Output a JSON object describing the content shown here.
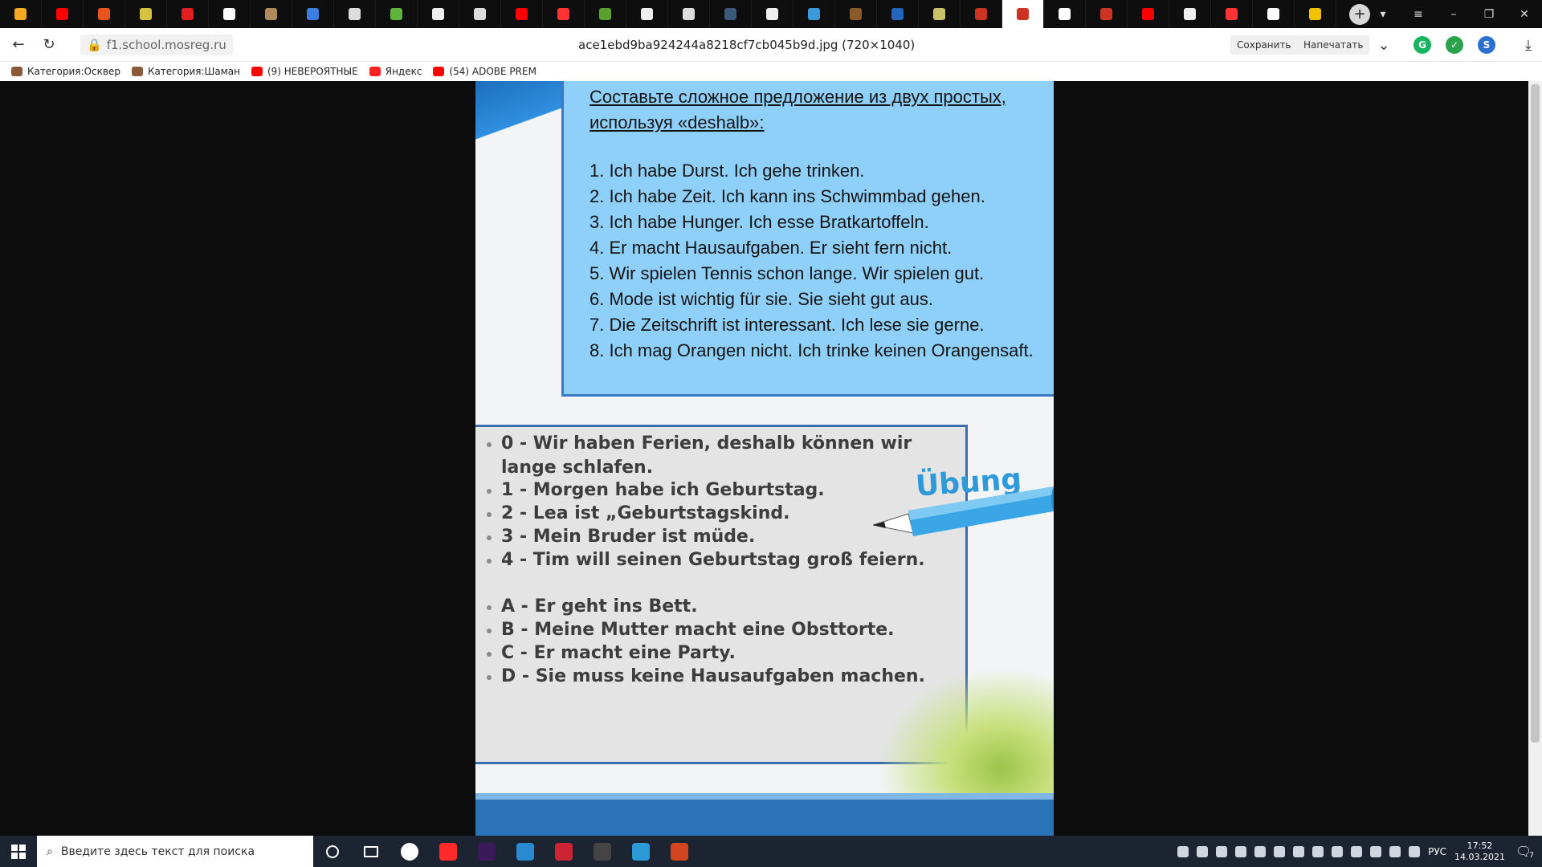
{
  "browser": {
    "active_tab_index": 24,
    "tab_colors": [
      "#f5a623",
      "#ff0000",
      "#e8531c",
      "#d6c23e",
      "#e02020",
      "#ffffff",
      "#b08a5a",
      "#3b7de0",
      "#dddddd",
      "#5fb43b",
      "#eeeeee",
      "#dddddd",
      "#ff0000",
      "#ff3333",
      "#5aa02c",
      "#eeeeee",
      "#dddddd",
      "#3b5a7a",
      "#eeeeee",
      "#3a9ad9",
      "#8a5a2a",
      "#2266bb",
      "#c9c26a",
      "#cc3322",
      "#cc3322",
      "#ffffff",
      "#cc3322",
      "#ff0000",
      "#eeeeee",
      "#ff3333",
      "#ffffff",
      "#f2c200"
    ],
    "url": "f1.school.mosreg.ru",
    "document_title": "ace1ebd9ba924244a8218cf7cb045b9d.jpg (720×1040)",
    "save_label": "Сохранить",
    "print_label": "Напечатать",
    "bookmarks": [
      {
        "label": "Категория:Осквер",
        "color": "#8a5a3a"
      },
      {
        "label": "Категория:Шаман",
        "color": "#8a5a3a"
      },
      {
        "label": "(9) НЕВЕРОЯТНЫЕ",
        "color": "#ff0000"
      },
      {
        "label": "Яндекс",
        "color": "#ff2222"
      },
      {
        "label": "(54) ADOBE PREM",
        "color": "#ff0000"
      }
    ]
  },
  "exercise": {
    "task_title": "Составьте сложное предложение из двух простых, используя «deshalb»:",
    "sentences": [
      "1. Ich habe Durst. Ich gehe trinken.",
      "2. Ich habe Zeit. Ich kann ins Schwimmbad gehen.",
      "3. Ich habe Hunger. Ich esse Bratkartoffeln.",
      "4. Er macht Hausaufgaben. Er sieht fern nicht.",
      "5. Wir spielen Tennis schon lange. Wir spielen gut.",
      "6. Mode ist wichtig für sie. Sie sieht gut aus.",
      "7. Die Zeitschrift ist interessant. Ich lese sie gerne.",
      "8. Ich mag Orangen nicht. Ich trinke keinen Orangensaft."
    ],
    "ubung_label": "Übung",
    "numbered_items": [
      "0 -    Wir haben Ferien,   deshalb können wir lange schlafen.",
      "1 -  Morgen habe ich Geburtstag.",
      "2 -  Lea ist „Geburtstagskind.",
      "3 -  Mein Bruder ist müde.",
      "4 -  Tim will seinen Geburtstag groß feiern."
    ],
    "lettered_items": [
      "A - Er geht ins Bett.",
      "B - Meine Mutter macht eine Obsttorte.",
      "C - Er macht eine Party.",
      "D - Sie muss keine Hausaufgaben machen."
    ]
  },
  "taskbar": {
    "search_placeholder": "Введите здесь текст для поиска",
    "language": "РУС",
    "time": "17:52",
    "date": "14.03.2021",
    "notification_count": "7",
    "app_colors": [
      "#ffffff",
      "#ff2a2a",
      "#3a1a5a",
      "#2a8ad0",
      "#cc2233",
      "#444444",
      "#2a9ad9",
      "#d2451e"
    ]
  }
}
